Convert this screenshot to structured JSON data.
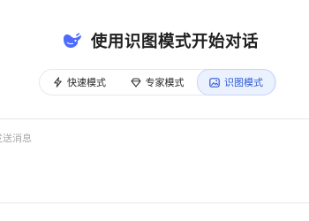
{
  "header": {
    "logo_icon": "deepseek-whale-icon",
    "title": "使用识图模式开始对话"
  },
  "modes": {
    "items": [
      {
        "label": "快速模式",
        "icon": "lightning-icon",
        "selected": false
      },
      {
        "label": "专家模式",
        "icon": "diamond-icon",
        "selected": false
      },
      {
        "label": "识图模式",
        "icon": "image-icon",
        "selected": true
      }
    ]
  },
  "composer": {
    "placeholder": "发送消息"
  },
  "colors": {
    "accent": "#4d6bfe",
    "selected_bg": "#ecf1fe",
    "selected_text": "#2d5bd8",
    "border": "#e4e6ec"
  }
}
